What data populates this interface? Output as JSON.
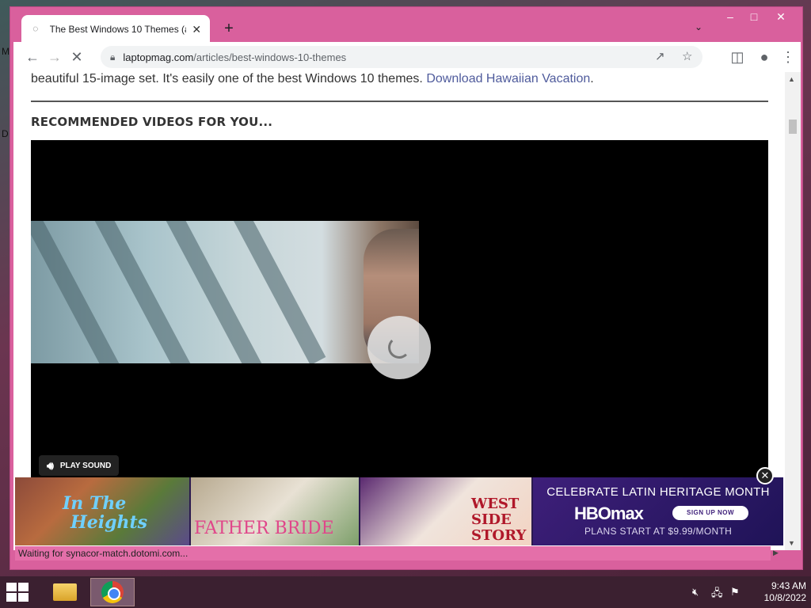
{
  "browser": {
    "tab_title": "The Best Windows 10 Themes (a",
    "new_tab_symbol": "+",
    "url_host": "laptopmag.com",
    "url_path": "/articles/best-windows-10-themes"
  },
  "page": {
    "intro_text": "beautiful 15-image set. It's easily one of the best Windows 10 themes. ",
    "intro_link": "Download Hawaiian Vacation",
    "intro_end": ".",
    "rec_heading": "RECOMMENDED VIDEOS FOR YOU...",
    "play_sound": "PLAY SOUND"
  },
  "ad": {
    "title1": "In The",
    "title1b": "Heights",
    "title2": "FATHER BRIDE",
    "title3": "WEST SIDE STORY",
    "headline": "CELEBRATE LATIN HERITAGE MONTH",
    "brand": "HBOmax",
    "cta": "SIGN UP NOW",
    "price": "PLANS START AT $9.99/MONTH"
  },
  "status_text": "Waiting for synacor-match.dotomi.com...",
  "taskbar": {
    "time": "9:43 AM",
    "date": "10/8/2022"
  },
  "desktop_edge": [
    "M",
    "D"
  ],
  "icons": [
    "back-icon",
    "forward-icon",
    "stop-icon",
    "lock-icon",
    "share-icon",
    "star-icon",
    "sidepanel-icon",
    "profile-icon",
    "menu-icon",
    "speaker-icon",
    "close-icon",
    "windows-start-icon",
    "file-explorer-icon",
    "chrome-icon",
    "volume-muted-icon",
    "network-icon",
    "action-center-icon"
  ],
  "colors": {
    "window_frame": "#d9609d",
    "link": "#4f5b9c",
    "ad_bg": "#3e1f7a"
  }
}
